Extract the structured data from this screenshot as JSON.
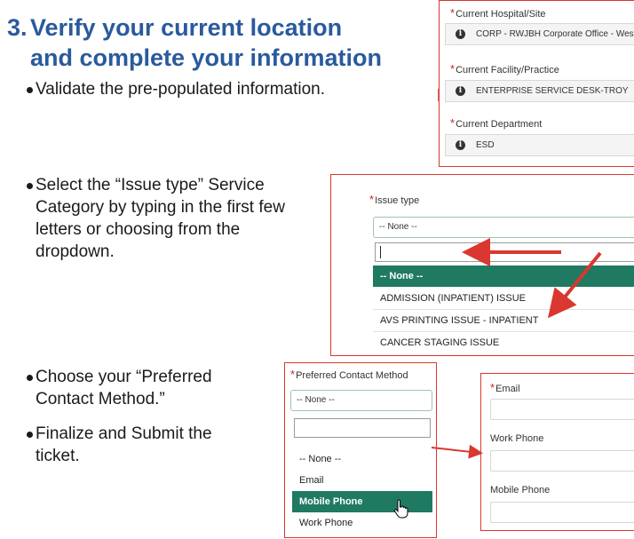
{
  "heading": {
    "number": "3.",
    "line1": "Verify your current location",
    "line2": "and complete your information"
  },
  "bullets": [
    "Validate the pre-populated information.",
    "Select the “Issue type” Service Category by typing in the first few letters or choosing from the dropdown.",
    "Choose your “Preferred Contact Method.”",
    "Finalize and Submit the ticket."
  ],
  "location_panel": {
    "hospital_label": "Current Hospital/Site",
    "hospital_value": "CORP - RWJBH Corporate Office - West",
    "facility_label": "Current Facility/Practice",
    "facility_value": "ENTERPRISE SERVICE DESK-TROY",
    "department_label": "Current Department",
    "department_value": "ESD",
    "info_icon": "info-circle-icon"
  },
  "issue_panel": {
    "label": "Issue type",
    "selected": "-- None --",
    "options": [
      "-- None --",
      "ADMISSION (INPATIENT) ISSUE",
      "AVS PRINTING ISSUE - INPATIENT",
      "CANCER STAGING ISSUE"
    ]
  },
  "contact_panel": {
    "label": "Preferred Contact Method",
    "selected": "-- None --",
    "options": [
      "-- None --",
      "Email",
      "Mobile Phone",
      "Work Phone"
    ]
  },
  "phone_panel": {
    "email_label": "Email",
    "work_phone_label": "Work Phone",
    "mobile_phone_label": "Mobile Phone"
  },
  "colors": {
    "heading": "#2a5a9c",
    "accent_green": "#207a62",
    "arrow_red": "#d9372f"
  }
}
